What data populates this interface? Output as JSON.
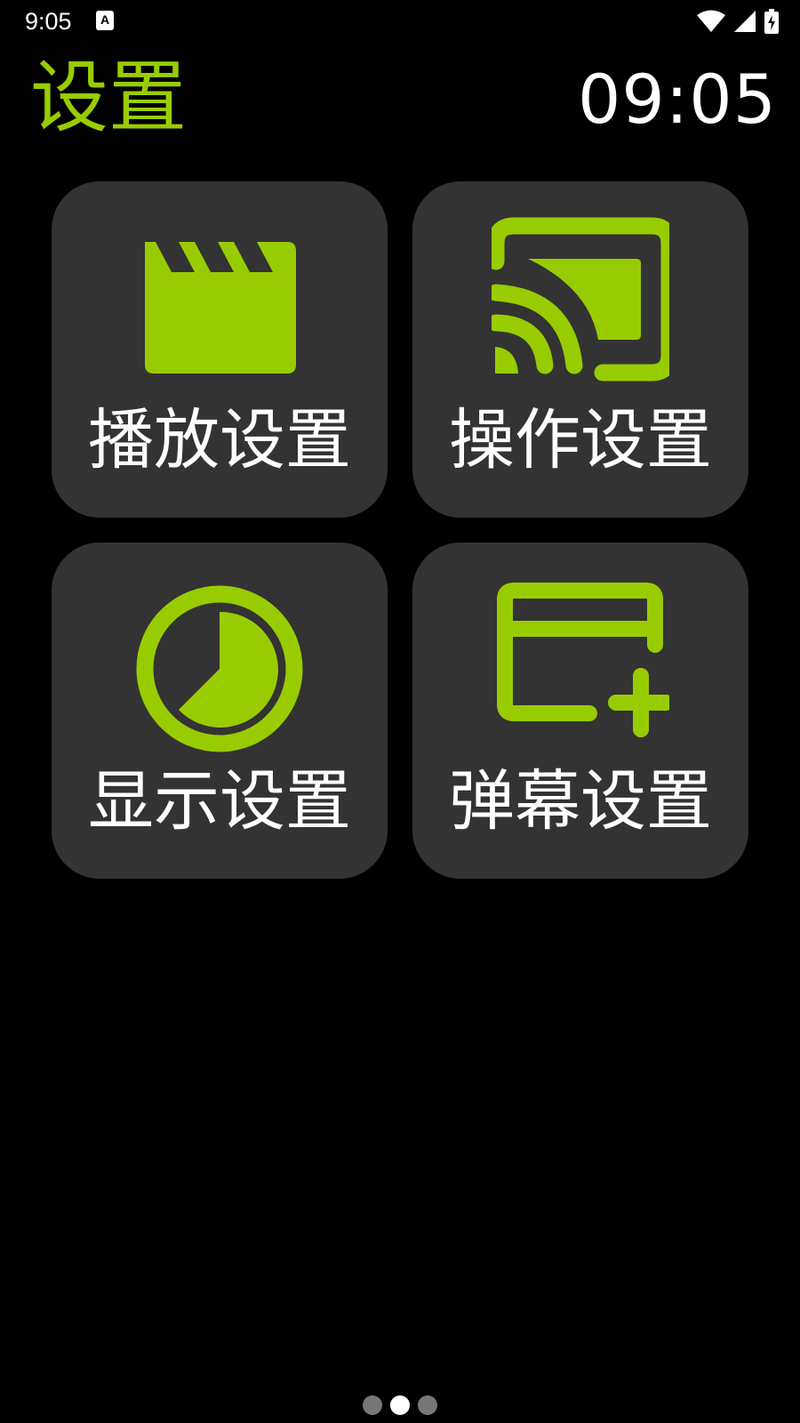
{
  "status_bar": {
    "time": "9:05",
    "icons": [
      "notification-a-icon",
      "wifi-icon",
      "cell-signal-icon",
      "battery-charging-icon"
    ]
  },
  "header": {
    "title": "设置",
    "clock": "09:05"
  },
  "tiles": [
    {
      "label": "播放设置",
      "icon": "clapperboard-icon"
    },
    {
      "label": "操作设置",
      "icon": "cast-icon"
    },
    {
      "label": "显示设置",
      "icon": "timer-icon"
    },
    {
      "label": "弹幕设置",
      "icon": "subtitle-add-icon"
    }
  ],
  "pager": {
    "count": 3,
    "active_index": 1
  },
  "colors": {
    "accent": "#99cc00",
    "tile_background": "#333333",
    "background": "#000000",
    "text": "#ffffff"
  }
}
